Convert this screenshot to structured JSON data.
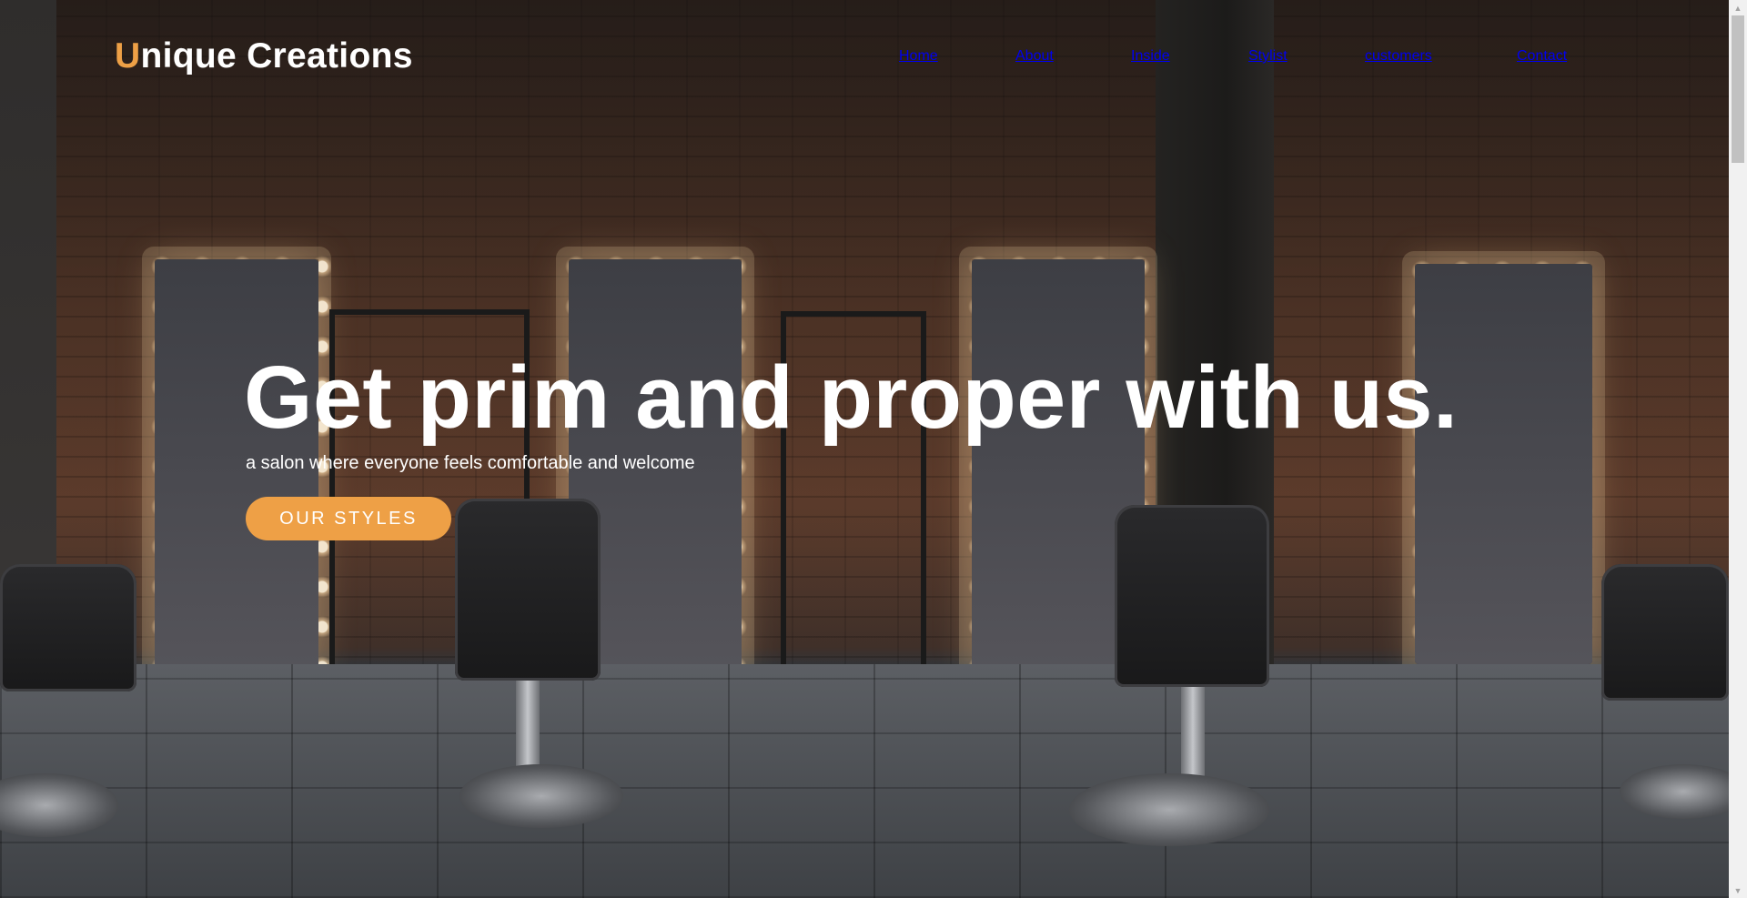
{
  "brand": {
    "first_letter": "U",
    "rest": "nique Creations",
    "accent_color": "#eea046"
  },
  "nav": {
    "items": [
      {
        "label": "Home"
      },
      {
        "label": "About"
      },
      {
        "label": "Inside"
      },
      {
        "label": "Stylist"
      },
      {
        "label": "customers"
      },
      {
        "label": "Contact"
      }
    ]
  },
  "hero": {
    "headline": "Get prim and proper with us.",
    "subheadline": "a salon where everyone feels comfortable and welcome",
    "cta_label": "OUR STYLES",
    "background_description_icon": "barbershop-scene"
  },
  "scrollbar": {
    "up_icon": "scroll-up-arrow-icon",
    "down_icon": "scroll-down-arrow-icon"
  }
}
